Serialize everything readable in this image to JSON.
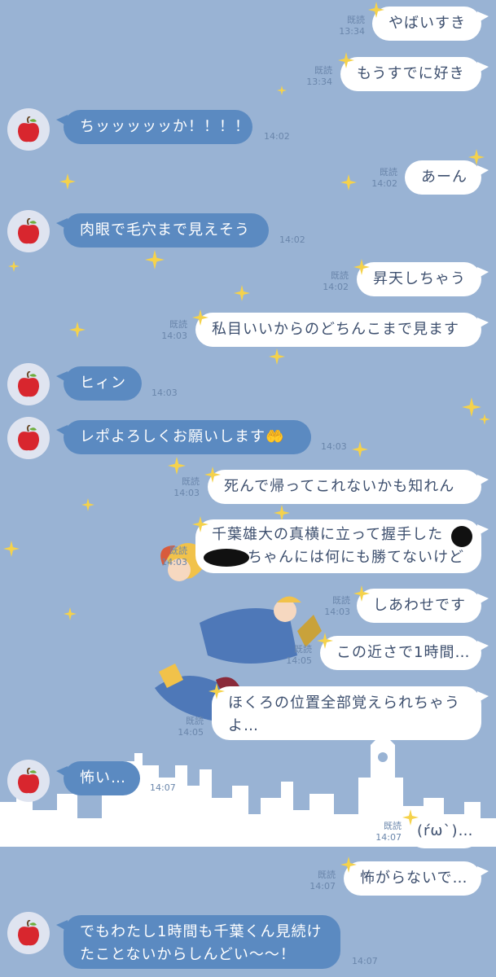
{
  "colors": {
    "background": "#99b3d4",
    "bubble_me": "#ffffff",
    "bubble_them": "#5b8ac1",
    "meta_text": "#6a86ab",
    "sparkle": "#f5d24b"
  },
  "contact": {
    "avatar_icon": "apple-icon"
  },
  "messages": [
    {
      "id": "m1",
      "sender": "me",
      "text": "やばいすき",
      "read": "既読",
      "time": "13:34"
    },
    {
      "id": "m2",
      "sender": "me",
      "text": "もうすでに好き",
      "read": "既読",
      "time": "13:34"
    },
    {
      "id": "m3",
      "sender": "them",
      "text": "ちッッッッッか！！！！",
      "time": "14:02"
    },
    {
      "id": "m4",
      "sender": "me",
      "text": "あーん",
      "read": "既読",
      "time": "14:02"
    },
    {
      "id": "m5",
      "sender": "them",
      "text": "肉眼で毛穴まで見えそう",
      "time": "14:02"
    },
    {
      "id": "m6",
      "sender": "me",
      "text": "昇天しちゃう",
      "read": "既読",
      "time": "14:02"
    },
    {
      "id": "m7",
      "sender": "me",
      "text": "私目いいからのどちんこまで見ます",
      "read": "既読",
      "time": "14:03"
    },
    {
      "id": "m8",
      "sender": "them",
      "text": "ヒィン",
      "time": "14:03"
    },
    {
      "id": "m9",
      "sender": "them",
      "text": "レポよろしくお願いします🤲",
      "time": "14:03"
    },
    {
      "id": "m10",
      "sender": "me",
      "text": "死んで帰ってこれないかも知れん",
      "read": "既読",
      "time": "14:03"
    },
    {
      "id": "m11",
      "sender": "me",
      "text_line1": "千葉雄大の真横に立って握手した",
      "text_line2": "ちゃんには何にも勝てないけど",
      "read": "既読",
      "time": "14:03"
    },
    {
      "id": "m12",
      "sender": "me",
      "text": "しあわせです",
      "read": "既読",
      "time": "14:03"
    },
    {
      "id": "m13",
      "sender": "me",
      "text": "この近さで1時間…",
      "read": "既読",
      "time": "14:05"
    },
    {
      "id": "m14",
      "sender": "me",
      "text": "ほくろの位置全部覚えられちゃうよ…",
      "read": "既読",
      "time": "14:05"
    },
    {
      "id": "m15",
      "sender": "them",
      "text": "怖い…",
      "time": "14:07"
    },
    {
      "id": "m16",
      "sender": "me",
      "text": "(ŕωˋ)…",
      "read": "既読",
      "time": "14:07"
    },
    {
      "id": "m17",
      "sender": "me",
      "text": "怖がらないで…",
      "read": "既読",
      "time": "14:07"
    },
    {
      "id": "m18",
      "sender": "them",
      "text": "でもわたし1時間も千葉くん見続けたことないからしんどい〜〜！",
      "time": "14:07"
    }
  ]
}
